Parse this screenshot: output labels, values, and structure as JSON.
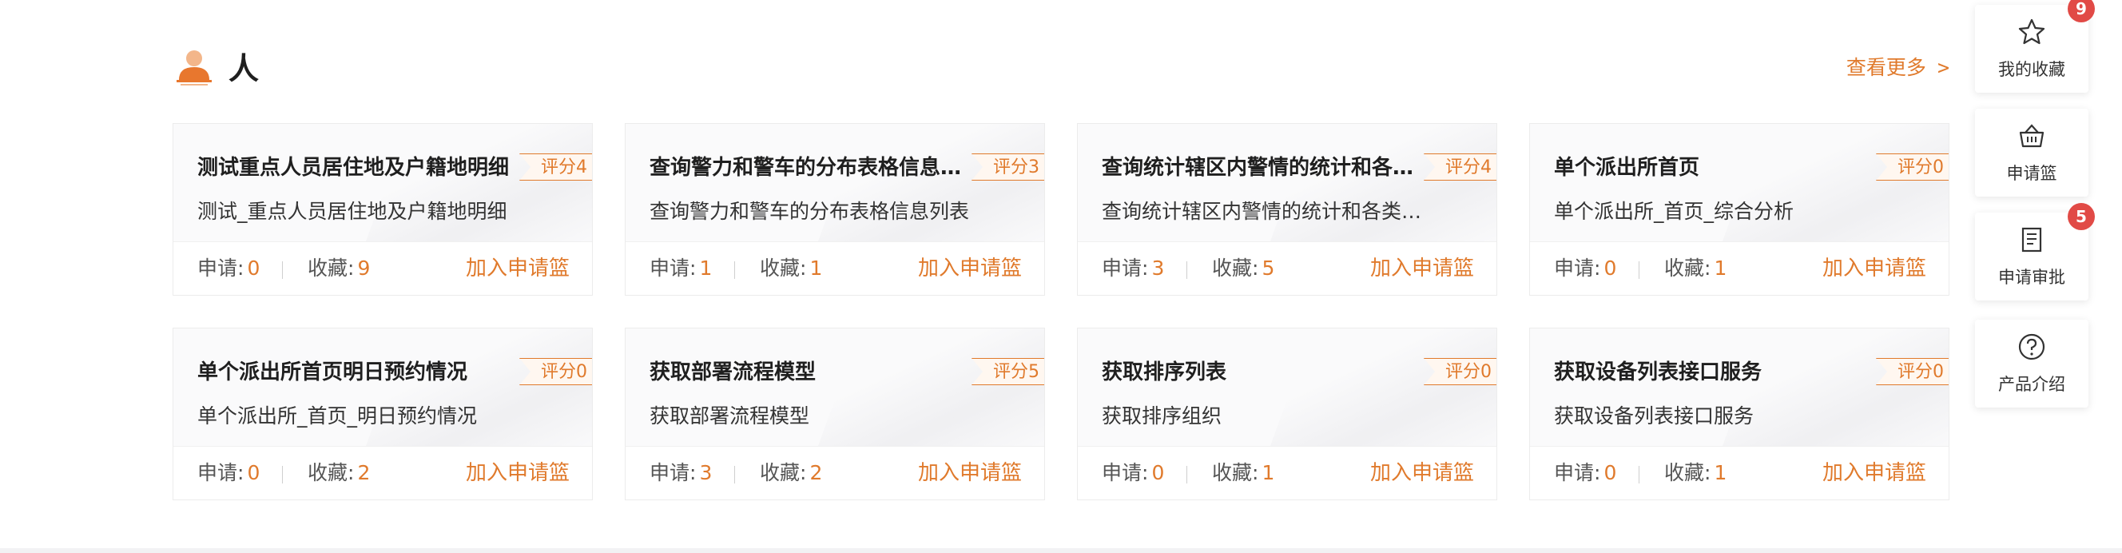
{
  "section": {
    "title": "人",
    "view_more": "查看更多",
    "view_more_arrow": ">"
  },
  "labels": {
    "apply": "申请:",
    "favorite": "收藏:",
    "add_to_basket": "加入申请篮"
  },
  "cards": [
    {
      "title": "测试重点人员居住地及户籍地明细",
      "score": "评分4",
      "desc": "测试_重点人员居住地及户籍地明细",
      "apply": "0",
      "fav": "9"
    },
    {
      "title": "查询警力和警车的分布表格信息列表",
      "score": "评分3",
      "desc": "查询警力和警车的分布表格信息列表",
      "apply": "1",
      "fav": "1"
    },
    {
      "title": "查询统计辖区内警情的统计和各类…",
      "score": "评分4",
      "desc": "查询统计辖区内警情的统计和各类…",
      "apply": "3",
      "fav": "5"
    },
    {
      "title": "单个派出所首页",
      "score": "评分0",
      "desc": "单个派出所_首页_综合分析",
      "apply": "0",
      "fav": "1"
    },
    {
      "title": "单个派出所首页明日预约情况",
      "score": "评分0",
      "desc": "单个派出所_首页_明日预约情况",
      "apply": "0",
      "fav": "2"
    },
    {
      "title": "获取部署流程模型",
      "score": "评分5",
      "desc": "获取部署流程模型",
      "apply": "3",
      "fav": "2"
    },
    {
      "title": "获取排序列表",
      "score": "评分0",
      "desc": "获取排序组织",
      "apply": "0",
      "fav": "1"
    },
    {
      "title": "获取设备列表接口服务",
      "score": "评分0",
      "desc": "获取设备列表接口服务",
      "apply": "0",
      "fav": "1"
    }
  ],
  "side_panel": [
    {
      "label": "我的收藏",
      "icon": "star-icon",
      "badge": "9"
    },
    {
      "label": "申请篮",
      "icon": "basket-icon",
      "badge": ""
    },
    {
      "label": "申请审批",
      "icon": "document-icon",
      "badge": "5"
    },
    {
      "label": "产品介绍",
      "icon": "question-circle-icon",
      "badge": ""
    }
  ],
  "colors": {
    "accent": "#e07a2c",
    "badge": "#e14a46"
  }
}
